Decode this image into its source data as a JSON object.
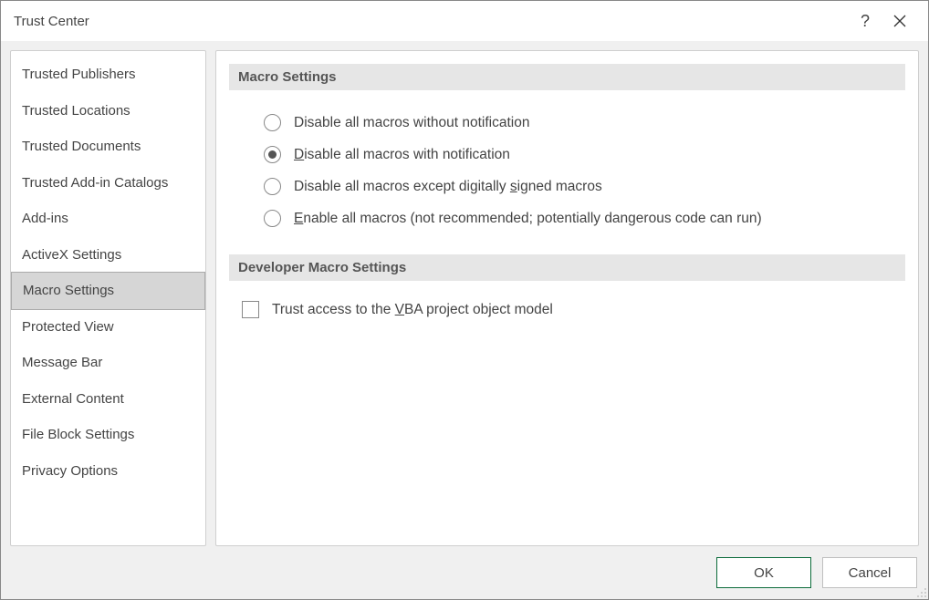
{
  "titlebar": {
    "title": "Trust Center"
  },
  "sidebar": {
    "items": [
      {
        "label": "Trusted Publishers",
        "selected": false
      },
      {
        "label": "Trusted Locations",
        "selected": false
      },
      {
        "label": "Trusted Documents",
        "selected": false
      },
      {
        "label": "Trusted Add-in Catalogs",
        "selected": false
      },
      {
        "label": "Add-ins",
        "selected": false
      },
      {
        "label": "ActiveX Settings",
        "selected": false
      },
      {
        "label": "Macro Settings",
        "selected": true
      },
      {
        "label": "Protected View",
        "selected": false
      },
      {
        "label": "Message Bar",
        "selected": false
      },
      {
        "label": "External Content",
        "selected": false
      },
      {
        "label": "File Block Settings",
        "selected": false
      },
      {
        "label": "Privacy Options",
        "selected": false
      }
    ]
  },
  "main": {
    "section1_header": "Macro Settings",
    "radios": [
      {
        "pre": "Disable all macros without notification",
        "accel": "",
        "post": "",
        "checked": false
      },
      {
        "pre": "",
        "accel": "D",
        "post": "isable all macros with notification",
        "checked": true
      },
      {
        "pre": "Disable all macros except digitally ",
        "accel": "s",
        "post": "igned macros",
        "checked": false
      },
      {
        "pre": "",
        "accel": "E",
        "post": "nable all macros (not recommended; potentially dangerous code can run)",
        "checked": false
      }
    ],
    "section2_header": "Developer Macro Settings",
    "checkbox": {
      "pre": "Trust access to the ",
      "accel": "V",
      "post": "BA project object model",
      "checked": false
    }
  },
  "footer": {
    "ok": "OK",
    "cancel": "Cancel"
  }
}
